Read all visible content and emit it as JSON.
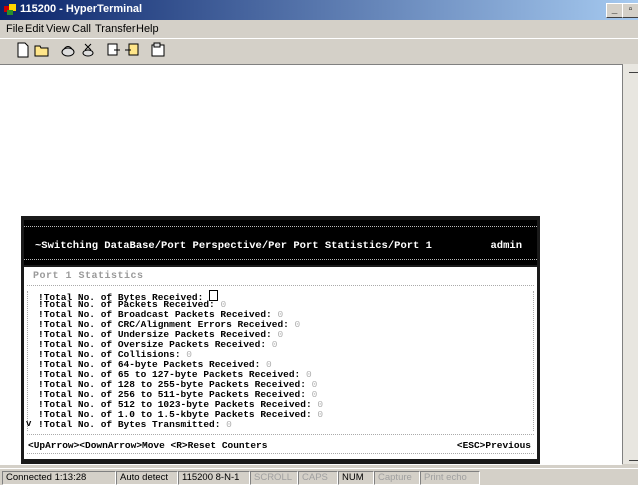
{
  "window": {
    "title": "115200 - HyperTerminal"
  },
  "menu": [
    "File",
    "Edit",
    "View",
    "Call",
    "Transfer",
    "Help"
  ],
  "toolbar_icons": [
    "new-icon",
    "open-icon",
    "connect-icon",
    "disconnect-icon",
    "send-icon",
    "receive-icon",
    "properties-icon"
  ],
  "terminal": {
    "header_path": "~Switching DataBase/Port Perspective/Per Port Statistics/Port  1",
    "header_user": "admin",
    "panel_title": "Port  1 Statistics",
    "stats": [
      {
        "label": "!Total No. of Bytes Received: ",
        "value": ""
      },
      {
        "label": "!Total No. of Packets Received: ",
        "value": "0"
      },
      {
        "label": "!Total No. of Broadcast Packets Received: ",
        "value": "0"
      },
      {
        "label": "!Total No. of CRC/Alignment Errors Received: ",
        "value": "0"
      },
      {
        "label": "!Total No. of Undersize Packets Received: ",
        "value": "0"
      },
      {
        "label": "!Total No. of Oversize Packets Received: ",
        "value": "0"
      },
      {
        "label": "!Total No. of Collisions: ",
        "value": "0"
      },
      {
        "label": "!Total No. of 64-byte Packets Received: ",
        "value": "0"
      },
      {
        "label": "!Total No. of 65 to 127-byte Packets Received: ",
        "value": "0"
      },
      {
        "label": "!Total No. of 128 to 255-byte Packets Received: ",
        "value": "0"
      },
      {
        "label": "!Total No. of 256 to 511-byte Packets Received: ",
        "value": "0"
      },
      {
        "label": "!Total No. of 512 to 1023-byte Packets Received: ",
        "value": "0"
      },
      {
        "label": "!Total No. of 1.0 to 1.5-kbyte Packets Received: ",
        "value": "0"
      },
      {
        "label": "!Total No. of Bytes Transmitted: ",
        "value": "0"
      }
    ],
    "scroll_indicator": "v",
    "footer_left": "<UpArrow><DownArrow>Move <R>Reset Counters",
    "footer_right": "<ESC>Previous"
  },
  "status": {
    "connected": "Connected 1:13:28",
    "detect": "Auto detect",
    "port": "115200 8-N-1",
    "scroll": "SCROLL",
    "caps": "CAPS",
    "num": "NUM",
    "capture": "Capture",
    "print_echo": "Print echo"
  }
}
